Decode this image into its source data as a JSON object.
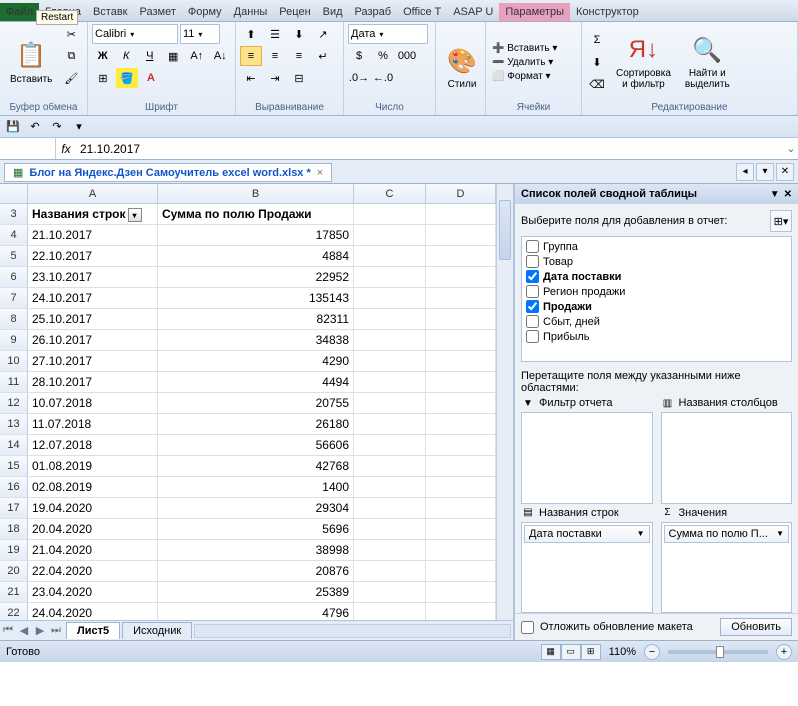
{
  "top_tabs": [
    "Файл",
    "Главна",
    "Вставк",
    "Размет",
    "Форму",
    "Данны",
    "Рецен",
    "Вид",
    "Разраб",
    "Office T",
    "ASAP U",
    "Параметры",
    "Конструктор"
  ],
  "restart_tip": "Restart",
  "ribbon": {
    "clipboard": {
      "label": "Буфер обмена",
      "paste": "Вставить"
    },
    "font": {
      "label": "Шрифт",
      "name": "Calibri",
      "size": "11",
      "bold": "Ж",
      "italic": "К",
      "underline": "Ч"
    },
    "align": {
      "label": "Выравнивание"
    },
    "number": {
      "label": "Число",
      "format": "Дата"
    },
    "styles": {
      "label": "Стили",
      "btn": "Стили"
    },
    "cells": {
      "label": "Ячейки",
      "insert": "Вставить",
      "delete": "Удалить",
      "format": "Формат"
    },
    "editing": {
      "label": "Редактирование",
      "sort": "Сортировка\nи фильтр",
      "find": "Найти и\nвыделить"
    }
  },
  "formula_bar": {
    "fx": "fx",
    "value": "21.10.2017"
  },
  "doc_tab": "Блог на Яндекс.Дзен Самоучитель excel word.xlsx *",
  "columns": [
    "A",
    "B",
    "C",
    "D"
  ],
  "header_row_num": "3",
  "headers": {
    "a": "Названия строк",
    "b": "Сумма по полю Продажи"
  },
  "rows": [
    {
      "n": "4",
      "a": "21.10.2017",
      "b": "17850"
    },
    {
      "n": "5",
      "a": "22.10.2017",
      "b": "4884"
    },
    {
      "n": "6",
      "a": "23.10.2017",
      "b": "22952"
    },
    {
      "n": "7",
      "a": "24.10.2017",
      "b": "135143"
    },
    {
      "n": "8",
      "a": "25.10.2017",
      "b": "82311"
    },
    {
      "n": "9",
      "a": "26.10.2017",
      "b": "34838"
    },
    {
      "n": "10",
      "a": "27.10.2017",
      "b": "4290"
    },
    {
      "n": "11",
      "a": "28.10.2017",
      "b": "4494"
    },
    {
      "n": "12",
      "a": "10.07.2018",
      "b": "20755"
    },
    {
      "n": "13",
      "a": "11.07.2018",
      "b": "26180"
    },
    {
      "n": "14",
      "a": "12.07.2018",
      "b": "56606"
    },
    {
      "n": "15",
      "a": "01.08.2019",
      "b": "42768"
    },
    {
      "n": "16",
      "a": "02.08.2019",
      "b": "1400"
    },
    {
      "n": "17",
      "a": "19.04.2020",
      "b": "29304"
    },
    {
      "n": "18",
      "a": "20.04.2020",
      "b": "5696"
    },
    {
      "n": "19",
      "a": "21.04.2020",
      "b": "38998"
    },
    {
      "n": "20",
      "a": "22.04.2020",
      "b": "20876"
    },
    {
      "n": "21",
      "a": "23.04.2020",
      "b": "25389"
    },
    {
      "n": "22",
      "a": "24.04.2020",
      "b": "4796"
    }
  ],
  "sheet_tabs": {
    "active": "Лист5",
    "other": "Исходник"
  },
  "side_panel": {
    "title": "Список полей сводной таблицы",
    "instruction": "Выберите поля для добавления в отчет:",
    "fields": [
      {
        "label": "Группа",
        "checked": false
      },
      {
        "label": "Товар",
        "checked": false
      },
      {
        "label": "Дата поставки",
        "checked": true
      },
      {
        "label": "Регион продажи",
        "checked": false
      },
      {
        "label": "Продажи",
        "checked": true
      },
      {
        "label": "Сбыт, дней",
        "checked": false
      },
      {
        "label": "Прибыль",
        "checked": false
      }
    ],
    "drag_text": "Перетащите поля между указанными ниже областями:",
    "zone_filter": "Фильтр отчета",
    "zone_cols": "Названия столбцов",
    "zone_rows": "Названия строк",
    "zone_vals": "Значения",
    "row_field": "Дата поставки",
    "val_field": "Сумма по полю П...",
    "defer": "Отложить обновление макета",
    "update": "Обновить"
  },
  "status": {
    "ready": "Готово",
    "zoom": "110%"
  }
}
